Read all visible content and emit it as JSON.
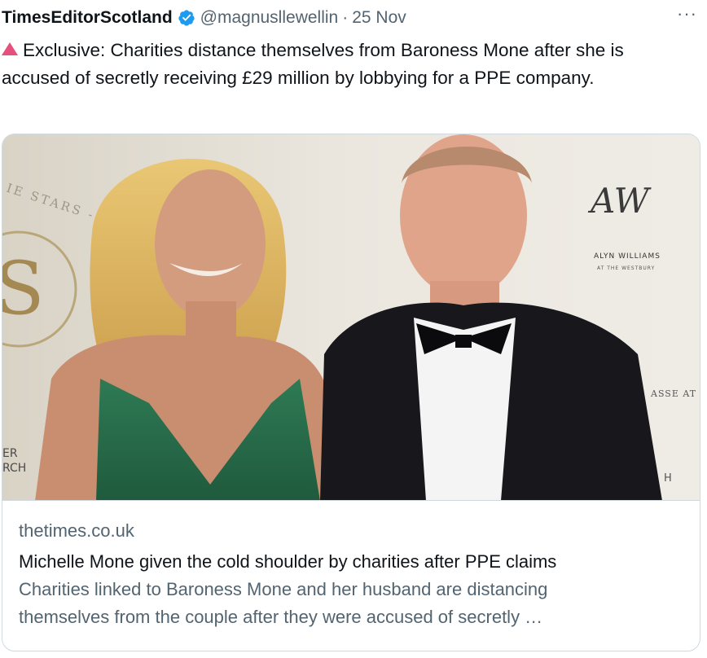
{
  "tweet": {
    "author_name": "TimesEditorScotland",
    "handle": "@magnusllewellin",
    "separator": "·",
    "date": "25 Nov",
    "more": "···",
    "text": "Exclusive: Charities distance themselves from Baroness Mone after she is accused of secretly receiving £29 million by lobbying for a PPE company."
  },
  "card": {
    "domain": "thetimes.co.uk",
    "title": "Michelle Mone given the cold shoulder by charities after PPE claims",
    "description_line1": "Charities linked to Baroness Mone and her husband are distancing",
    "description_line2": "themselves from the couple after they were accused of secretly …",
    "backdrop": {
      "logo_letters": "AW",
      "logo_name": "ALYN WILLIAMS",
      "logo_sub": "AT THE WESTBURY",
      "arc_text_left": "IE STARS - DINING WITH",
      "left_edge_1": "ER",
      "left_edge_2": "RCH",
      "right_edge_1": "ASSE AT",
      "right_edge_2": "H"
    }
  },
  "colors": {
    "verified_blue": "#1d9bf0",
    "emoji_red": "#e0245e",
    "secondary_text": "#536471"
  },
  "icons": {
    "verified": "verified-badge-icon",
    "more": "more-options-icon",
    "red_triangle": "red-triangle-up-icon"
  }
}
